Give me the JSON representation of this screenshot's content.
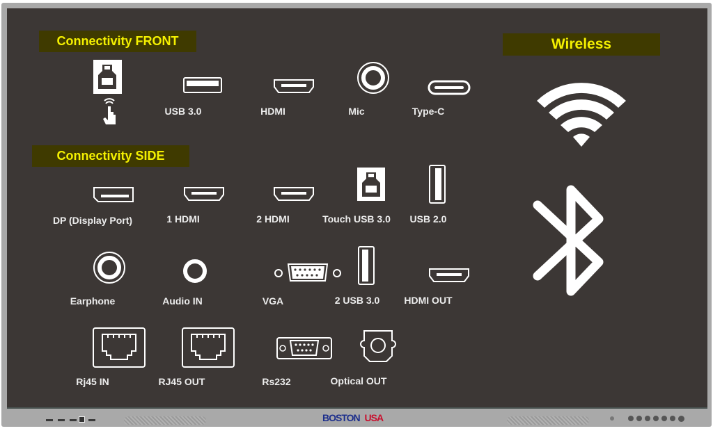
{
  "sections": {
    "front": "Connectivity FRONT",
    "side": "Connectivity SIDE",
    "wireless": "Wireless"
  },
  "front_ports": [
    {
      "label": "",
      "icon": "touch-usb-b-icon"
    },
    {
      "label": "USB 3.0",
      "icon": "usb-a-icon"
    },
    {
      "label": "HDMI",
      "icon": "hdmi-icon"
    },
    {
      "label": "Mic",
      "icon": "audio-jack-icon"
    },
    {
      "label": "Type-C",
      "icon": "usb-c-icon"
    }
  ],
  "side_ports": [
    {
      "label": "DP (Display Port)",
      "icon": "displayport-icon"
    },
    {
      "label": "1 HDMI",
      "icon": "hdmi-icon"
    },
    {
      "label": "2 HDMI",
      "icon": "hdmi-icon"
    },
    {
      "label": "Touch USB 3.0",
      "icon": "usb-b-icon"
    },
    {
      "label": "USB 2.0",
      "icon": "usb-a-vertical-icon"
    },
    {
      "label": "Earphone",
      "icon": "audio-jack-icon"
    },
    {
      "label": "Audio IN",
      "icon": "audio-jack-icon"
    },
    {
      "label": "VGA",
      "icon": "vga-icon"
    },
    {
      "label": "2 USB 3.0",
      "icon": "usb-a-vertical-icon"
    },
    {
      "label": "HDMI OUT",
      "icon": "hdmi-icon"
    },
    {
      "label": "Rj45 IN",
      "icon": "rj45-icon"
    },
    {
      "label": "RJ45 OUT",
      "icon": "rj45-icon"
    },
    {
      "label": "Rs232",
      "icon": "rs232-icon"
    },
    {
      "label": "Optical OUT",
      "icon": "optical-icon"
    }
  ],
  "wireless_icons": [
    "wifi-icon",
    "bluetooth-icon"
  ],
  "brand": {
    "part1": "BOSTON",
    "part2": "USA",
    "color1": "#1d2f8c",
    "color2": "#c8102e"
  },
  "colors": {
    "screen": "#3c3735",
    "header_bg": "#3f3a00",
    "header_text": "#f4f000",
    "bezel": "#a9a9a9"
  }
}
